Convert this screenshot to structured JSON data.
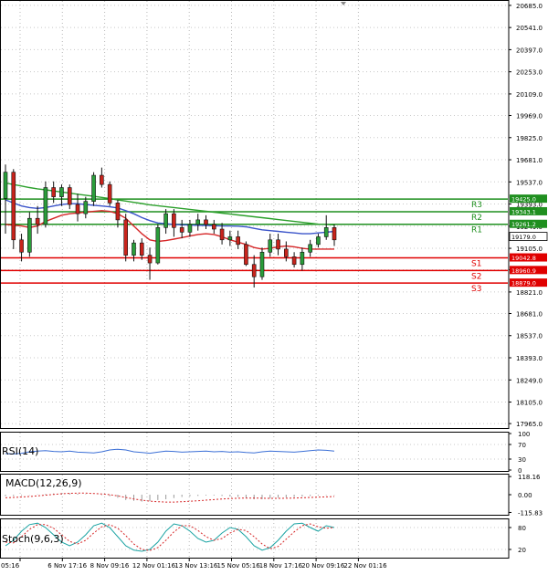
{
  "chart_data": [
    {
      "type": "candlestick",
      "panel": "price",
      "y_ticks": [
        "20685.0",
        "20541.0",
        "20397.0",
        "20253.0",
        "20109.0",
        "19969.0",
        "19825.0",
        "19681.0",
        "19537.0",
        "19393.0",
        "19249.0",
        "19105.0",
        "18965.0",
        "18821.0",
        "18681.0",
        "18537.0",
        "18393.0",
        "18249.0",
        "18105.0",
        "17965.0"
      ],
      "ylim": [
        17930,
        20720
      ],
      "candles": [
        [
          19430,
          19650,
          19200,
          19600
        ],
        [
          19600,
          19620,
          19100,
          19160
        ],
        [
          19160,
          19200,
          19020,
          19080
        ],
        [
          19080,
          19340,
          19050,
          19300
        ],
        [
          19300,
          19380,
          19200,
          19260
        ],
        [
          19260,
          19540,
          19240,
          19500
        ],
        [
          19500,
          19540,
          19400,
          19440
        ],
        [
          19440,
          19520,
          19380,
          19500
        ],
        [
          19500,
          19520,
          19360,
          19390
        ],
        [
          19390,
          19460,
          19280,
          19330
        ],
        [
          19330,
          19440,
          19300,
          19410
        ],
        [
          19410,
          19600,
          19380,
          19580
        ],
        [
          19580,
          19630,
          19500,
          19520
        ],
        [
          19520,
          19540,
          19380,
          19400
        ],
        [
          19400,
          19420,
          19240,
          19290
        ],
        [
          19290,
          19330,
          19020,
          19060
        ],
        [
          19060,
          19160,
          19020,
          19140
        ],
        [
          19140,
          19170,
          19030,
          19060
        ],
        [
          19060,
          19110,
          18900,
          19010
        ],
        [
          19010,
          19260,
          19000,
          19240
        ],
        [
          19240,
          19360,
          19200,
          19330
        ],
        [
          19330,
          19360,
          19180,
          19240
        ],
        [
          19240,
          19290,
          19170,
          19210
        ],
        [
          19210,
          19290,
          19180,
          19260
        ],
        [
          19260,
          19330,
          19220,
          19290
        ],
        [
          19290,
          19320,
          19230,
          19260
        ],
        [
          19260,
          19290,
          19200,
          19230
        ],
        [
          19230,
          19270,
          19130,
          19160
        ],
        [
          19160,
          19220,
          19120,
          19180
        ],
        [
          19180,
          19220,
          19100,
          19130
        ],
        [
          19130,
          19150,
          18990,
          19000
        ],
        [
          19000,
          19060,
          18850,
          18920
        ],
        [
          18920,
          19110,
          18900,
          19080
        ],
        [
          19080,
          19200,
          19050,
          19160
        ],
        [
          19160,
          19200,
          19060,
          19100
        ],
        [
          19100,
          19150,
          19020,
          19050
        ],
        [
          19050,
          19080,
          18980,
          19000
        ],
        [
          19000,
          19110,
          18960,
          19080
        ],
        [
          19080,
          19160,
          19050,
          19130
        ],
        [
          19130,
          19200,
          19110,
          19180
        ],
        [
          19180,
          19320,
          19160,
          19240
        ],
        [
          19240,
          19260,
          19120,
          19160
        ]
      ],
      "moving_averages": [
        {
          "color": "#2ca02c",
          "values": [
            19530,
            19520,
            19510,
            19500,
            19492,
            19485,
            19478,
            19471,
            19464,
            19457,
            19450,
            19443,
            19436,
            19428,
            19420,
            19412,
            19404,
            19396,
            19388,
            19382,
            19376,
            19370,
            19364,
            19358,
            19352,
            19346,
            19340,
            19334,
            19328,
            19322,
            19316,
            19310,
            19304,
            19298,
            19292,
            19286,
            19280,
            19274,
            19268,
            19262,
            19260,
            19258
          ]
        },
        {
          "color": "#3a53c9",
          "values": [
            19420,
            19400,
            19380,
            19370,
            19365,
            19370,
            19380,
            19390,
            19395,
            19395,
            19390,
            19385,
            19380,
            19375,
            19368,
            19350,
            19330,
            19305,
            19285,
            19270,
            19265,
            19260,
            19258,
            19256,
            19255,
            19254,
            19252,
            19250,
            19250,
            19249,
            19245,
            19235,
            19225,
            19220,
            19215,
            19210,
            19205,
            19200,
            19200,
            19205,
            19210,
            19215
          ]
        },
        {
          "color": "#d62728",
          "values": [
            19260,
            19255,
            19250,
            19240,
            19250,
            19280,
            19300,
            19320,
            19330,
            19335,
            19340,
            19345,
            19350,
            19345,
            19330,
            19300,
            19250,
            19200,
            19160,
            19150,
            19155,
            19165,
            19175,
            19185,
            19195,
            19200,
            19195,
            19180,
            19160,
            19145,
            19130,
            19110,
            19100,
            19105,
            19115,
            19120,
            19115,
            19105,
            19100,
            19100,
            19100,
            19100
          ]
        }
      ],
      "levels": [
        {
          "name": "R3",
          "value": 19425.0,
          "price_label": "19425.0",
          "color": "#1f8f1f"
        },
        {
          "name": "R2",
          "value": 19343.1,
          "price_label": "19343.1",
          "color": "#1f8f1f"
        },
        {
          "name": "R1",
          "value": 19261.2,
          "price_label": "19261.2",
          "color": "#1f8f1f"
        },
        {
          "name": "S1",
          "value": 19042.8,
          "price_label": "19042.8",
          "color": "#e00000"
        },
        {
          "name": "S2",
          "value": 18960.9,
          "price_label": "18960.9",
          "color": "#e00000"
        },
        {
          "name": "S3",
          "value": 18879.0,
          "price_label": "18879.0",
          "color": "#e00000"
        }
      ],
      "current_price": "19179.0",
      "x_ticks": [
        "05:16",
        "6 Nov 17:16",
        "8 Nov 09:16",
        "12 Nov 01:16",
        "13 Nov 13:16",
        "15 Nov 05:16",
        "18 Nov 17:16",
        "20 Nov 09:16",
        "22 Nov 01:16"
      ]
    },
    {
      "type": "line",
      "panel": "rsi",
      "label": "RSI(14)",
      "y_ticks": [
        "100",
        "70",
        "30",
        "0"
      ],
      "ylim": [
        0,
        100
      ],
      "values": [
        45,
        44,
        46,
        50,
        52,
        53,
        51,
        50,
        52,
        49,
        48,
        47,
        50,
        55,
        57,
        55,
        50,
        48,
        46,
        49,
        52,
        51,
        49,
        50,
        51,
        52,
        50,
        51,
        49,
        50,
        48,
        47,
        50,
        52,
        51,
        50,
        49,
        51,
        53,
        55,
        54,
        52
      ]
    },
    {
      "type": "line",
      "panel": "macd",
      "label": "MACD(12,26,9)",
      "y_ticks": [
        "118.16",
        "0.00",
        "-115.83"
      ],
      "ylim": [
        -125,
        125
      ],
      "histogram": [
        -10,
        -8,
        -5,
        -2,
        2,
        5,
        8,
        10,
        9,
        6,
        3,
        0,
        -3,
        -10,
        -20,
        -35,
        -40,
        -45,
        -42,
        -35,
        -30,
        -22,
        -15,
        -10,
        -8,
        -5,
        -5,
        -8,
        -12,
        -15,
        -22,
        -30,
        -30,
        -25,
        -20,
        -18,
        -15,
        -12,
        -8,
        -5,
        -3,
        -2
      ],
      "signal": [
        -20,
        -18,
        -15,
        -12,
        -8,
        -3,
        2,
        6,
        9,
        10,
        10,
        8,
        5,
        0,
        -8,
        -18,
        -28,
        -36,
        -42,
        -46,
        -48,
        -48,
        -46,
        -43,
        -40,
        -36,
        -32,
        -28,
        -25,
        -23,
        -22,
        -22,
        -23,
        -24,
        -24,
        -23,
        -22,
        -20,
        -18,
        -16,
        -14,
        -12
      ]
    },
    {
      "type": "line",
      "panel": "stoch",
      "label": "Stoch(9,6,3)",
      "y_ticks": [
        "80",
        "20"
      ],
      "ylim": [
        0,
        100
      ],
      "k": [
        30,
        45,
        70,
        88,
        92,
        80,
        60,
        40,
        30,
        40,
        60,
        85,
        92,
        80,
        55,
        30,
        18,
        15,
        20,
        40,
        70,
        90,
        85,
        70,
        50,
        40,
        45,
        65,
        80,
        75,
        55,
        30,
        18,
        25,
        45,
        70,
        90,
        92,
        80,
        70,
        85,
        80
      ],
      "d": [
        40,
        38,
        55,
        75,
        88,
        88,
        78,
        60,
        42,
        35,
        45,
        65,
        82,
        88,
        78,
        58,
        35,
        20,
        17,
        25,
        45,
        68,
        85,
        85,
        72,
        55,
        45,
        50,
        65,
        75,
        72,
        55,
        35,
        22,
        28,
        48,
        68,
        85,
        90,
        82,
        78,
        80
      ]
    }
  ]
}
